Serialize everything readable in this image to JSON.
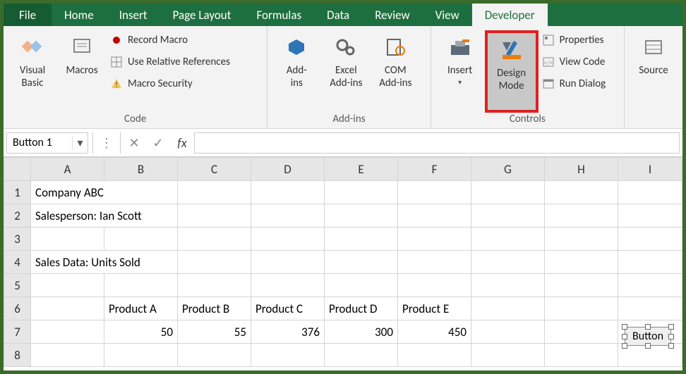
{
  "tabs": {
    "file": "File",
    "list": [
      "Home",
      "Insert",
      "Page Layout",
      "Formulas",
      "Data",
      "Review",
      "View",
      "Developer"
    ],
    "active": "Developer"
  },
  "ribbon": {
    "code": {
      "visual_basic": "Visual\nBasic",
      "macros": "Macros",
      "record": "Record Macro",
      "relative": "Use Relative References",
      "security": "Macro Security",
      "label": "Code"
    },
    "addins": {
      "addins": "Add-\nins",
      "excel": "Excel\nAdd-ins",
      "com": "COM\nAdd-ins",
      "label": "Add-ins"
    },
    "controls": {
      "insert": "Insert",
      "design": "Design\nMode",
      "properties": "Properties",
      "viewcode": "View Code",
      "rundialog": "Run Dialog",
      "label": "Controls"
    },
    "source": "Source"
  },
  "formula_bar": {
    "name": "Button 1",
    "fx": "fx",
    "value": ""
  },
  "columns": [
    "A",
    "B",
    "C",
    "D",
    "E",
    "F",
    "G",
    "H",
    "I"
  ],
  "rows": {
    "1": {
      "A": "Company ABC"
    },
    "2": {
      "A": "Salesperson: Ian Scott"
    },
    "3": {},
    "4": {
      "A": "Sales Data: Units Sold"
    },
    "5": {},
    "6": {
      "B": "Product A",
      "C": "Product B",
      "D": "Product C",
      "E": "Product D",
      "F": "Product E"
    },
    "7": {
      "B": "50",
      "C": "55",
      "D": "376",
      "E": "300",
      "F": "450"
    },
    "8": {}
  },
  "object_button": "Button"
}
